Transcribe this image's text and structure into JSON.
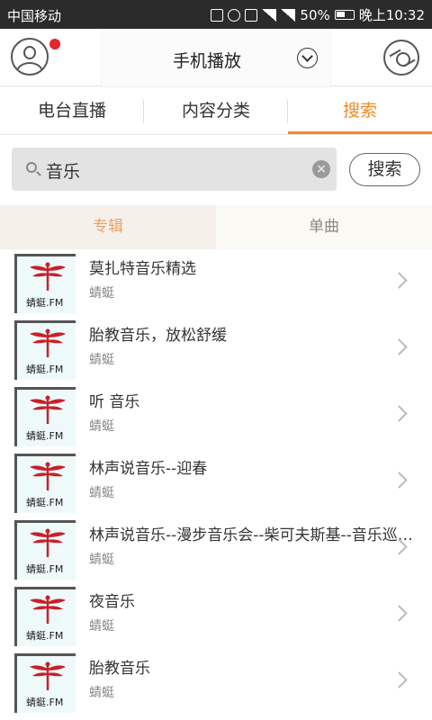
{
  "status_bar": {
    "carrier": "中国移动",
    "battery": "50%",
    "time": "晚上10:32"
  },
  "header": {
    "title": "手机播放"
  },
  "tabs": [
    {
      "label": "电台直播"
    },
    {
      "label": "内容分类"
    },
    {
      "label": "搜索"
    }
  ],
  "search": {
    "value": "音乐",
    "button": "搜索"
  },
  "subtabs": [
    {
      "label": "专辑"
    },
    {
      "label": "单曲"
    }
  ],
  "colors": {
    "accent": "#f08a2a"
  },
  "thumb_label": "蜻蜓.FM",
  "results": [
    {
      "title": "莫扎特音乐精选",
      "source": "蜻蜓"
    },
    {
      "title": "胎教音乐，放松舒缓",
      "source": "蜻蜓"
    },
    {
      "title": "听 音乐",
      "source": "蜻蜓"
    },
    {
      "title": "林声说音乐--迎春",
      "source": "蜻蜓"
    },
    {
      "title": "林声说音乐--漫步音乐会--柴可夫斯基--音乐巡…",
      "source": "蜻蜓"
    },
    {
      "title": "夜音乐",
      "source": "蜻蜓"
    },
    {
      "title": "胎教音乐",
      "source": "蜻蜓"
    }
  ]
}
